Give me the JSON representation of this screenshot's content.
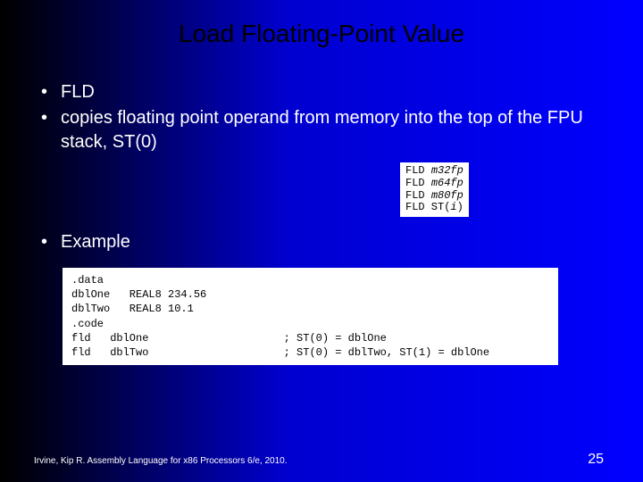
{
  "title": "Load Floating-Point Value",
  "bullets": {
    "b1": "FLD",
    "b2": "copies floating point operand from memory into the top of the FPU stack, ST(0)"
  },
  "opcodes": {
    "l1a": "FLD ",
    "l1b": "m32fp",
    "l2a": "FLD ",
    "l2b": "m64fp",
    "l3a": "FLD ",
    "l3b": "m80fp",
    "l4a": "FLD ST(",
    "l4b": "i",
    "l4c": ")"
  },
  "example_label": "Example",
  "code": {
    "l1": ".data",
    "l2": "dblOne   REAL8 234.56",
    "l3": "dblTwo   REAL8 10.1",
    "l4": ".code",
    "l5": "fld   dblOne                     ; ST(0) = dblOne",
    "l6": "fld   dblTwo                     ; ST(0) = dblTwo, ST(1) = dblOne"
  },
  "footer": {
    "citation": "Irvine, Kip R. Assembly Language for x86 Processors 6/e, 2010.",
    "page": "25"
  }
}
